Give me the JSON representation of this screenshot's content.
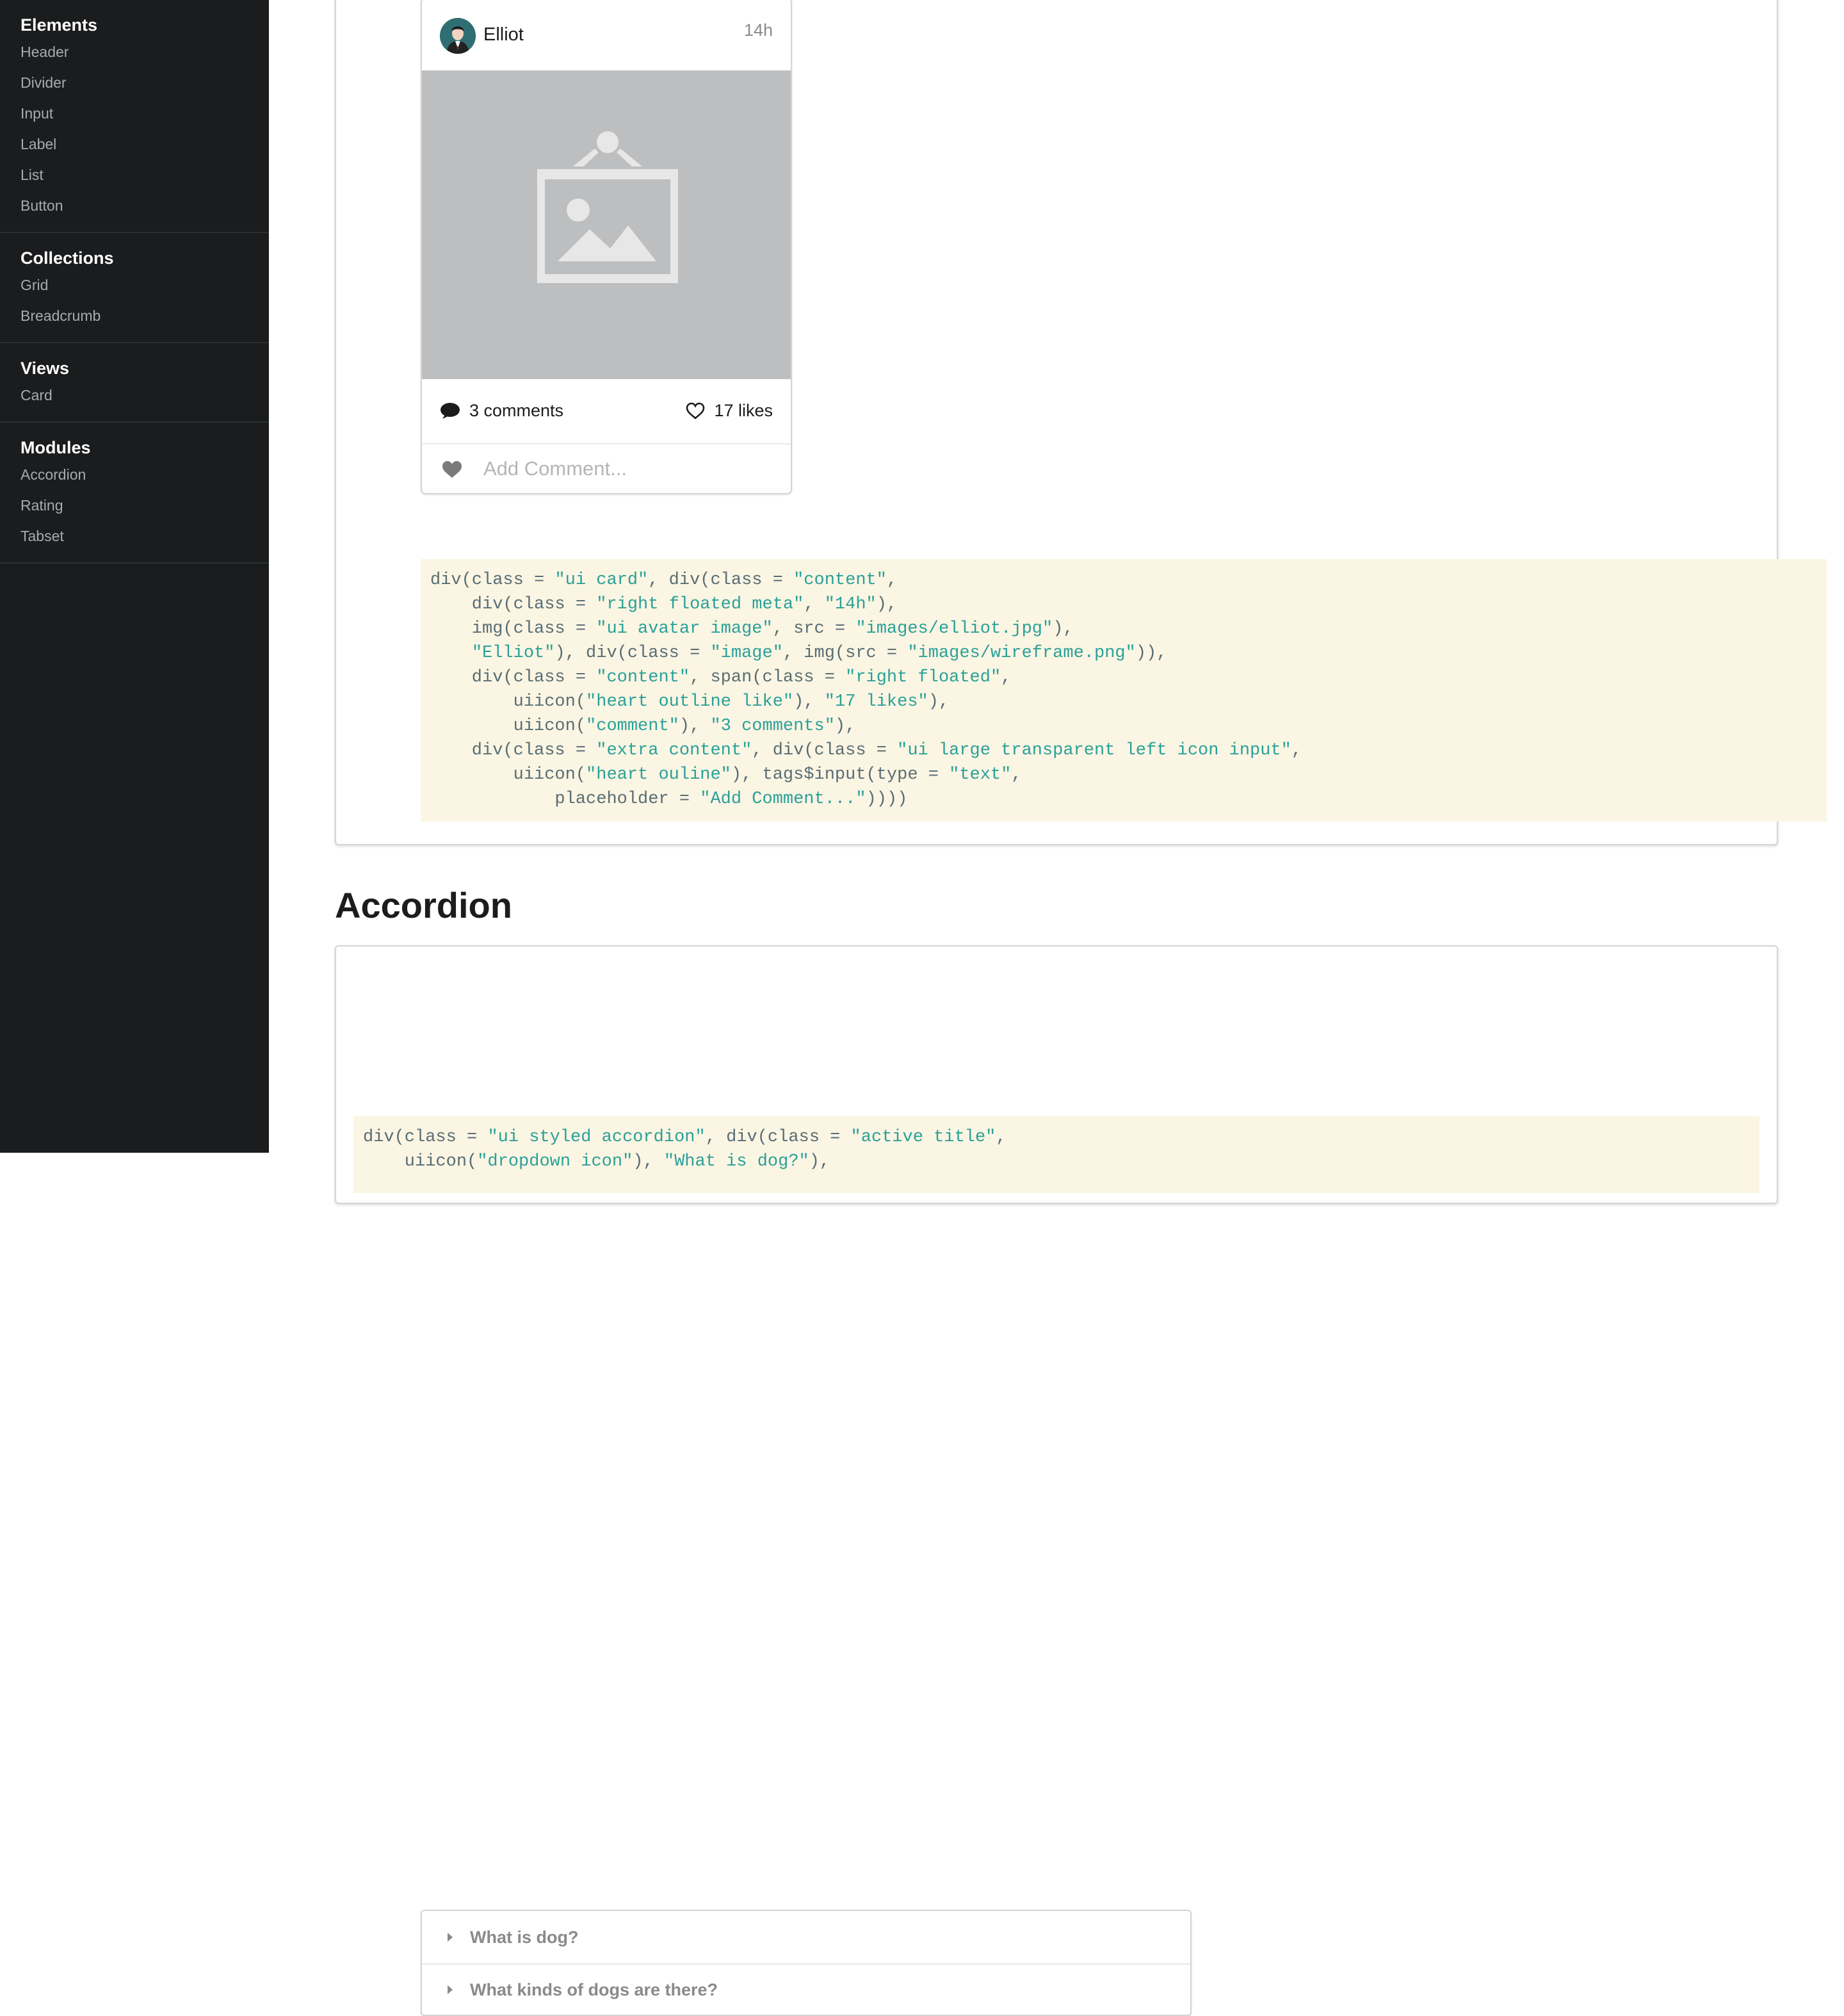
{
  "sidebar": {
    "groups": [
      {
        "header": "Elements",
        "items": [
          "Header",
          "Divider",
          "Input",
          "Label",
          "List",
          "Button"
        ]
      },
      {
        "header": "Collections",
        "items": [
          "Grid",
          "Breadcrumb"
        ]
      },
      {
        "header": "Views",
        "items": [
          "Card"
        ]
      },
      {
        "header": "Modules",
        "items": [
          "Accordion",
          "Rating",
          "Tabset"
        ]
      }
    ]
  },
  "card": {
    "author": "Elliot",
    "meta": "14h",
    "comments": "3 comments",
    "likes": "17 likes",
    "comment_placeholder": "Add Comment..."
  },
  "card_code": [
    [
      [
        "div(class = ",
        ""
      ],
      [
        "\"ui card\"",
        "s"
      ],
      [
        ", div(class = ",
        ""
      ],
      [
        "\"content\"",
        "s"
      ],
      [
        ",",
        ""
      ]
    ],
    [
      [
        "    div(class = ",
        ""
      ],
      [
        "\"right floated meta\"",
        "s"
      ],
      [
        ", ",
        ""
      ],
      [
        "\"14h\"",
        "s"
      ],
      [
        "),",
        ""
      ]
    ],
    [
      [
        "    img(class = ",
        ""
      ],
      [
        "\"ui avatar image\"",
        "s"
      ],
      [
        ", src = ",
        ""
      ],
      [
        "\"images/elliot.jpg\"",
        "s"
      ],
      [
        "),",
        ""
      ]
    ],
    [
      [
        "    ",
        ""
      ],
      [
        "\"Elliot\"",
        "s"
      ],
      [
        "), div(class = ",
        ""
      ],
      [
        "\"image\"",
        "s"
      ],
      [
        ", img(src = ",
        ""
      ],
      [
        "\"images/wireframe.png\"",
        "s"
      ],
      [
        ")),",
        ""
      ]
    ],
    [
      [
        "    div(class = ",
        ""
      ],
      [
        "\"content\"",
        "s"
      ],
      [
        ", span(class = ",
        ""
      ],
      [
        "\"right floated\"",
        "s"
      ],
      [
        ",",
        ""
      ]
    ],
    [
      [
        "        uiicon(",
        ""
      ],
      [
        "\"heart outline like\"",
        "s"
      ],
      [
        "), ",
        ""
      ],
      [
        "\"17 likes\"",
        "s"
      ],
      [
        "),",
        ""
      ]
    ],
    [
      [
        "        uiicon(",
        ""
      ],
      [
        "\"comment\"",
        "s"
      ],
      [
        "), ",
        ""
      ],
      [
        "\"3 comments\"",
        "s"
      ],
      [
        "),",
        ""
      ]
    ],
    [
      [
        "    div(class = ",
        ""
      ],
      [
        "\"extra content\"",
        "s"
      ],
      [
        ", div(class = ",
        ""
      ],
      [
        "\"ui large transparent left icon input\"",
        "s"
      ],
      [
        ",",
        ""
      ]
    ],
    [
      [
        "        uiicon(",
        ""
      ],
      [
        "\"heart ouline\"",
        "s"
      ],
      [
        "), tags$input(type = ",
        ""
      ],
      [
        "\"text\"",
        "s"
      ],
      [
        ",",
        ""
      ]
    ],
    [
      [
        "            placeholder = ",
        ""
      ],
      [
        "\"Add Comment...\"",
        "s"
      ],
      [
        "))))",
        ""
      ]
    ]
  ],
  "accordion_section": {
    "title": "Accordion",
    "items": [
      "What is dog?",
      "What kinds of dogs are there?"
    ]
  },
  "accordion_code": [
    [
      [
        "div(class = ",
        ""
      ],
      [
        "\"ui styled accordion\"",
        "s"
      ],
      [
        ", div(class = ",
        ""
      ],
      [
        "\"active title\"",
        "s"
      ],
      [
        ",",
        ""
      ]
    ],
    [
      [
        "    uiicon(",
        ""
      ],
      [
        "\"dropdown icon\"",
        "s"
      ],
      [
        "), ",
        ""
      ],
      [
        "\"What is dog?\"",
        "s"
      ],
      [
        "),",
        ""
      ]
    ]
  ],
  "colors": {
    "sidebar_bg": "#1b1c1d",
    "code_bg": "#fbf5e3",
    "code_text": "#586e75",
    "code_string": "#2aa198"
  }
}
